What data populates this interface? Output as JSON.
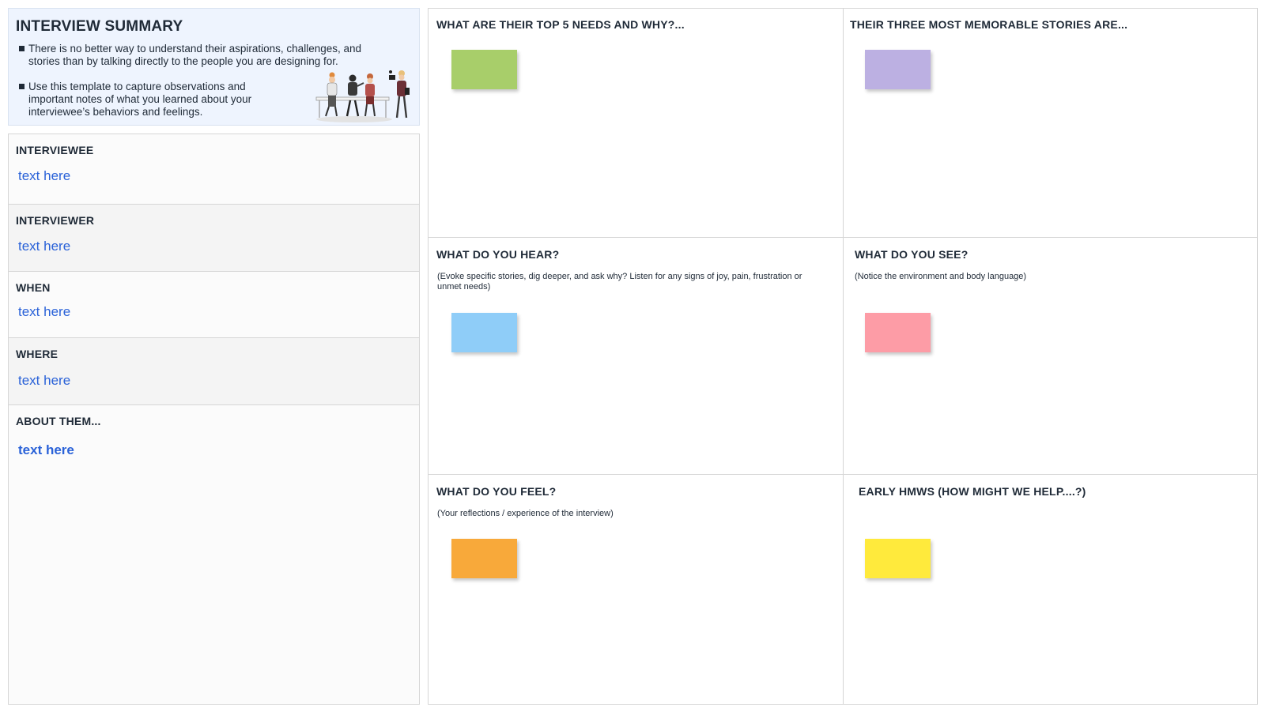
{
  "intro": {
    "title": "INTERVIEW SUMMARY",
    "bullets": [
      "There is no better way to understand their aspirations, challenges, and stories than by talking directly to the people you are designing for.",
      "Use this template to capture observations and important notes of what you learned about your interviewee’s behaviors and feelings."
    ]
  },
  "info": [
    {
      "label": "INTERVIEWEE",
      "value": "text here"
    },
    {
      "label": "INTERVIEWER",
      "value": "text here"
    },
    {
      "label": "WHEN",
      "value": "text here"
    },
    {
      "label": "WHERE",
      "value": "text here"
    },
    {
      "label": "ABOUT THEM...",
      "value": "text here"
    }
  ],
  "quadrants": [
    {
      "title": "WHAT ARE THEIR TOP 5 NEEDS AND WHY?...",
      "subtitle": "",
      "sticky_color": "#a8ce6a"
    },
    {
      "title": "THEIR THREE MOST MEMORABLE STORIES ARE...",
      "subtitle": "",
      "sticky_color": "#bcb0e2"
    },
    {
      "title": "WHAT DO YOU HEAR?",
      "subtitle": "(Evoke specific stories, dig deeper, and ask why? Listen for any signs of joy, pain, frustration or unmet needs)",
      "sticky_color": "#8fcdf8"
    },
    {
      "title": "WHAT DO YOU SEE?",
      "subtitle": "(Notice the environment and body language)",
      "sticky_color": "#fd9ca6"
    },
    {
      "title": "WHAT DO YOU FEEL?",
      "subtitle": "(Your reflections / experience of the interview)",
      "sticky_color": "#f8a93a"
    },
    {
      "title": "EARLY HMWS (HOW MIGHT WE HELP....?)",
      "subtitle": "",
      "sticky_color": "#ffea3c"
    }
  ],
  "colors": {
    "accent_text": "#2a62d8",
    "intro_background": "#eef4fe",
    "alt_row_background": "#f4f4f4",
    "row_background": "#fbfbfb"
  },
  "icons": {
    "illustration": "interview-people-illustration"
  }
}
